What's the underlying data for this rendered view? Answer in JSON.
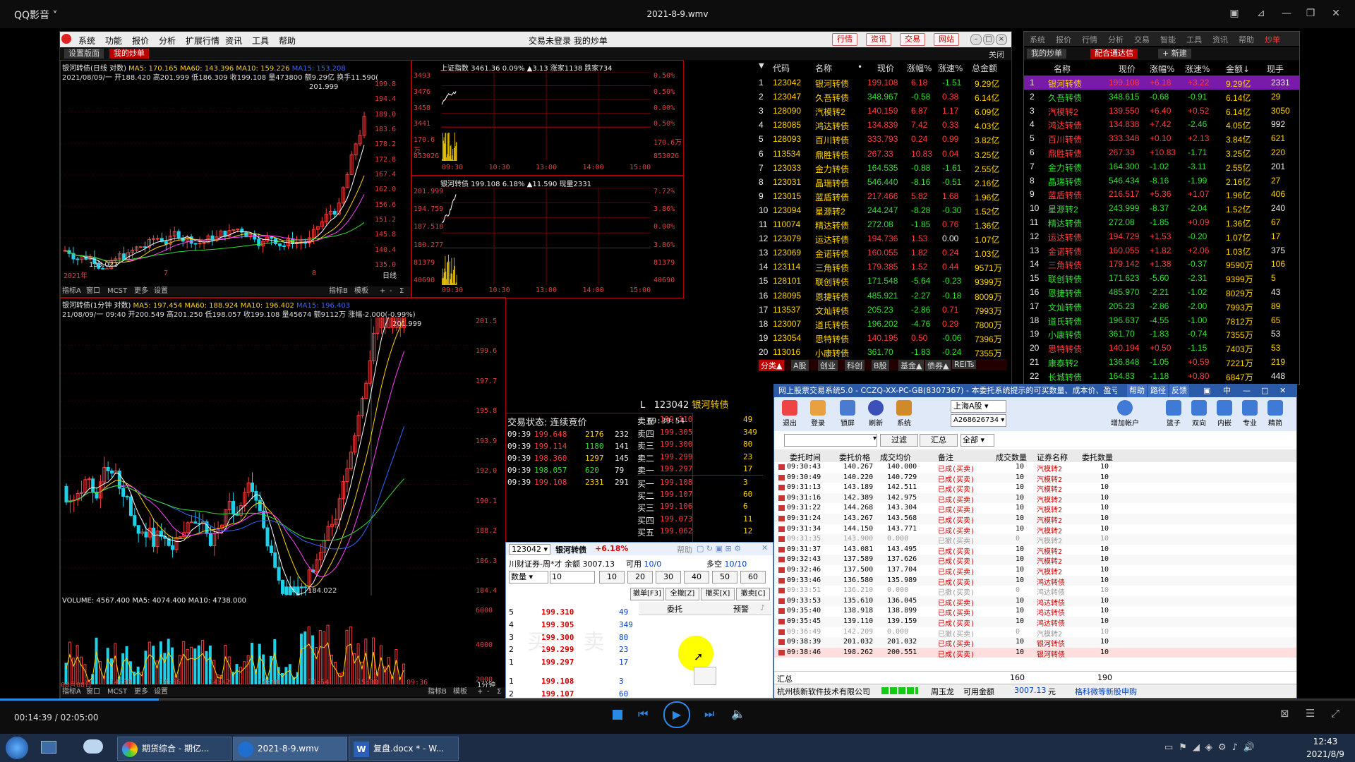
{
  "player": {
    "brand": "QQ影音 ˅",
    "file_title": "2021-8-9.wmv",
    "time": "00:14:39 / 02:05:00",
    "progress": 0.117
  },
  "app": {
    "menu": [
      "系统",
      "功能",
      "报价",
      "分析",
      "扩展行情",
      "资讯",
      "工具",
      "帮助"
    ],
    "center_title": "交易未登录 我的炒单",
    "tool_buttons": [
      "行情",
      "资讯",
      "交易",
      "网站"
    ],
    "close_label": "关闭",
    "tabs": [
      "设置版面",
      "我的炒单"
    ]
  },
  "daily_chart": {
    "header1_name": "银河转债(日线 对数)",
    "header1_ma": "MA5: 170.165  MA60: 143.396  MA10: 159.226",
    "header1_extra": "MA15: 153.208",
    "header2": "2021/08/09/一 开188.420 高201.999 低186.309 收199.108 量473800 额9.29亿 换手11.590(",
    "max_label": "201.999",
    "min_label": "133.023",
    "yaxis": [
      "199.8",
      "194.4",
      "189.0",
      "183.6",
      "178.2",
      "172.8",
      "167.4",
      "162.0",
      "156.6",
      "151.2",
      "145.8",
      "140.4",
      "135.0"
    ],
    "xlabels": [
      "2021年",
      "7",
      "8"
    ],
    "period": "日线",
    "bottom": [
      "指标A",
      "窗口",
      "MCST",
      "更多",
      "设置"
    ],
    "bottom_right": [
      "指标B",
      "模板",
      "+",
      "-",
      "Σ"
    ]
  },
  "index_chart": {
    "header": "上证指数  3461.36  0.09%  ▲3.13  涨家1138  跌家734",
    "yleft": [
      "3493",
      "3476",
      "3458",
      "3441",
      "170.6万",
      "853026"
    ],
    "yright": [
      "0.50%",
      "0.50%",
      "0.00%",
      "0.50%",
      "170.6万",
      "853026"
    ],
    "xlabels": [
      "09:30",
      "10:30",
      "13:00",
      "14:00",
      "15:00"
    ]
  },
  "bond_intraday": {
    "header": "银河转债  199.108  6.18%  ▲11.590  现量2331",
    "yleft": [
      "201.999",
      "194.759",
      "187.518",
      "180.277",
      "81379",
      "40690"
    ],
    "yright": [
      "7.72%",
      "3.86%",
      "0.00%",
      "3.86%",
      "81379",
      "40690"
    ],
    "xlabels": [
      "09:30",
      "10:30",
      "13:00",
      "14:00",
      "15:00"
    ]
  },
  "min_chart": {
    "header1_name": "银河转债(1分钟 对数)",
    "header1_ma": "MA5: 197.454  MA60: 188.924  MA10: 196.402",
    "header1_extra": "MA15: 196.403",
    "header2": "21/08/09/一 09:40 开200.549 高201.250 低198.057 收199.108 量45674 额9112万 涨幅-2.000(-0.99%)",
    "max_label": "201.999",
    "min_label": "184.022",
    "yaxis": [
      "201.5",
      "199.6",
      "197.7",
      "195.8",
      "193.9",
      "192.0",
      "190.1",
      "188.2",
      "186.3",
      "184.4"
    ],
    "volume_header": "VOLUME: 4567.400  MA5: 4074.400  MA10: 4738.000",
    "vol_axis": [
      "6000",
      "4000",
      "2000"
    ],
    "xlabels": [
      "08月08日",
      "14:30",
      "14:36",
      "14:42",
      "14:48",
      "14:54",
      "15:00",
      "09:36"
    ],
    "period": "1分钟",
    "bottom": [
      "指标A",
      "窗口",
      "MCST",
      "更多",
      "设置"
    ],
    "bottom_right": [
      "指标B",
      "模板",
      "+",
      "-",
      "Σ"
    ]
  },
  "quote_table": {
    "headers": [
      "代码",
      "名称",
      "•",
      "现价",
      "涨幅%",
      "涨速%",
      "总金额"
    ],
    "rows": [
      [
        "1",
        "123042",
        "银河转债",
        "199.108",
        "6.18",
        "-1.51",
        "9.29亿"
      ],
      [
        "2",
        "123047",
        "久吾转债",
        "348.967",
        "-0.58",
        "0.38",
        "6.14亿"
      ],
      [
        "3",
        "128090",
        "汽模转2",
        "140.159",
        "6.87",
        "1.17",
        "6.09亿"
      ],
      [
        "4",
        "128085",
        "鸿达转债",
        "134.839",
        "7.42",
        "0.33",
        "4.03亿"
      ],
      [
        "5",
        "128093",
        "百川转债",
        "333.793",
        "0.24",
        "0.99",
        "3.82亿"
      ],
      [
        "6",
        "113534",
        "鼎胜转债",
        "267.33",
        "10.83",
        "0.04",
        "3.25亿"
      ],
      [
        "7",
        "123033",
        "金力转债",
        "164.535",
        "-0.88",
        "-1.61",
        "2.55亿"
      ],
      [
        "8",
        "123031",
        "晶瑞转债",
        "546.440",
        "-8.16",
        "-0.51",
        "2.16亿"
      ],
      [
        "9",
        "123015",
        "蓝盾转债",
        "217.466",
        "5.82",
        "1.68",
        "1.96亿"
      ],
      [
        "10",
        "123094",
        "星源转2",
        "244.247",
        "-8.28",
        "-0.30",
        "1.52亿"
      ],
      [
        "11",
        "110074",
        "精达转债",
        "272.08",
        "-1.85",
        "0.76",
        "1.36亿"
      ],
      [
        "12",
        "123079",
        "运达转债",
        "194.736",
        "1.53",
        "0.00",
        "1.07亿"
      ],
      [
        "13",
        "123069",
        "金诺转债",
        "160.055",
        "1.82",
        "0.24",
        "1.03亿"
      ],
      [
        "14",
        "123114",
        "三角转债",
        "179.385",
        "1.52",
        "0.44",
        "9571万"
      ],
      [
        "15",
        "128101",
        "联创转债",
        "171.548",
        "-5.64",
        "-0.23",
        "9399万"
      ],
      [
        "16",
        "128095",
        "恩捷转债",
        "485.921",
        "-2.27",
        "-0.18",
        "8009万"
      ],
      [
        "17",
        "113537",
        "文灿转债",
        "205.23",
        "-2.86",
        "0.71",
        "7993万"
      ],
      [
        "18",
        "123007",
        "道氏转债",
        "196.202",
        "-4.76",
        "0.29",
        "7800万"
      ],
      [
        "19",
        "123054",
        "思特转债",
        "140.195",
        "0.50",
        "-0.06",
        "7396万"
      ],
      [
        "20",
        "113016",
        "小康转债",
        "361.70",
        "-1.83",
        "-0.24",
        "7355万"
      ]
    ],
    "bottom_tabs": [
      "分类▲",
      "A股",
      "创业",
      "科创",
      "B股",
      "基金▲",
      "债券▲",
      "REITs"
    ]
  },
  "right_panel": {
    "menu": [
      "系统",
      "报价",
      "行情",
      "分析",
      "交易",
      "智能",
      "工具",
      "资讯",
      "帮助",
      "炒单"
    ],
    "tabs": [
      "我的炒单",
      "配合通达信",
      "+ 新建"
    ],
    "headers": [
      "名称",
      "现价",
      "涨幅%",
      "涨速%",
      "金额↓",
      "现手"
    ],
    "rows": [
      [
        "1",
        "银河转债",
        "199.108",
        "+6.18",
        "+3.22",
        "9.29亿",
        "2331"
      ],
      [
        "2",
        "久吾转债",
        "348.615",
        "-0.68",
        "-0.91",
        "6.14亿",
        "29"
      ],
      [
        "3",
        "汽模转2",
        "139.550",
        "+6.40",
        "+0.52",
        "6.14亿",
        "3050"
      ],
      [
        "4",
        "鸿达转债",
        "134.838",
        "+7.42",
        "-2.46",
        "4.05亿",
        "992"
      ],
      [
        "5",
        "百川转债",
        "333.348",
        "+0.10",
        "+2.13",
        "3.84亿",
        "621"
      ],
      [
        "6",
        "鼎胜转债",
        "267.33",
        "+10.83",
        "-1.71",
        "3.25亿",
        "220"
      ],
      [
        "7",
        "金力转债",
        "164.300",
        "-1.02",
        "-3.11",
        "2.55亿",
        "201"
      ],
      [
        "8",
        "晶瑞转债",
        "546.434",
        "-8.16",
        "-1.99",
        "2.16亿",
        "27"
      ],
      [
        "9",
        "蓝盾转债",
        "216.517",
        "+5.36",
        "+1.07",
        "1.96亿",
        "406"
      ],
      [
        "10",
        "星源转2",
        "243.999",
        "-8.37",
        "-2.04",
        "1.52亿",
        "240"
      ],
      [
        "11",
        "精达转债",
        "272.08",
        "-1.85",
        "+0.09",
        "1.36亿",
        "67"
      ],
      [
        "12",
        "运达转债",
        "194.729",
        "+1.53",
        "-0.20",
        "1.07亿",
        "17"
      ],
      [
        "13",
        "金诺转债",
        "160.055",
        "+1.82",
        "+2.06",
        "1.03亿",
        "375"
      ],
      [
        "14",
        "三角转债",
        "179.142",
        "+1.38",
        "-0.37",
        "9590万",
        "106"
      ],
      [
        "15",
        "联创转债",
        "171.623",
        "-5.60",
        "-2.31",
        "9399万",
        "5"
      ],
      [
        "16",
        "恩捷转债",
        "485.970",
        "-2.21",
        "-1.02",
        "8029万",
        "43"
      ],
      [
        "17",
        "文灿转债",
        "205.23",
        "-2.86",
        "-2.00",
        "7993万",
        "89"
      ],
      [
        "18",
        "道氏转债",
        "196.637",
        "-4.55",
        "-1.00",
        "7812万",
        "65"
      ],
      [
        "19",
        "小康转债",
        "361.70",
        "-1.83",
        "-0.74",
        "7355万",
        "53"
      ],
      [
        "20",
        "思特转债",
        "140.194",
        "+0.50",
        "-1.15",
        "7403万",
        "53"
      ],
      [
        "21",
        "康泰转2",
        "136.848",
        "-1.05",
        "+0.59",
        "7221万",
        "219"
      ],
      [
        "22",
        "长城转债",
        "164.83",
        "-1.18",
        "+0.80",
        "6847万",
        "448"
      ]
    ]
  },
  "tick": {
    "status": "交易状态: 连续竞价",
    "status_time": "09:39:54",
    "rows": [
      [
        "09:39",
        "199.648",
        "2176",
        "232"
      ],
      [
        "09:39",
        "199.114",
        "1180",
        "141"
      ],
      [
        "09:39",
        "198.360",
        "1297",
        "145"
      ],
      [
        "09:39",
        "198.057",
        "620",
        "79"
      ],
      [
        "09:39",
        "199.108",
        "2331",
        "291"
      ]
    ],
    "code_label": "L",
    "code": "123042",
    "name": "银河转债",
    "book": [
      [
        "卖五",
        "199.310",
        "49"
      ],
      [
        "卖四",
        "199.305",
        "349"
      ],
      [
        "卖三",
        "199.300",
        "80"
      ],
      [
        "卖二",
        "199.299",
        "23"
      ],
      [
        "卖一",
        "199.297",
        "17"
      ],
      [
        "买一",
        "199.108",
        "3"
      ],
      [
        "买二",
        "199.107",
        "60"
      ],
      [
        "买三",
        "199.106",
        "6"
      ],
      [
        "买四",
        "199.073",
        "11"
      ],
      [
        "买五",
        "199.062",
        "12"
      ]
    ]
  },
  "order_panel": {
    "code": "123042 ▾",
    "name": "银河转债",
    "change": "+6.18%",
    "top_right": "帮助",
    "account": "川财证券-周*才 余额 3007.13",
    "avail_label": "可用",
    "avail": "10/0",
    "short_label": "多空",
    "short": "10/10",
    "qty_label": "数量",
    "qty": "10",
    "qty_buttons": [
      "10",
      "20",
      "30",
      "40",
      "50",
      "60"
    ],
    "action_buttons": [
      "撤单[F3]",
      "全撤[Z]",
      "撤买[X]",
      "撤卖[C]"
    ],
    "book": [
      [
        "5",
        "199.310",
        "49"
      ],
      [
        "4",
        "199.305",
        "349"
      ],
      [
        "3",
        "199.300",
        "80"
      ],
      [
        "2",
        "199.299",
        "23"
      ],
      [
        "1",
        "199.297",
        "17"
      ],
      [
        "1",
        "199.108",
        "3"
      ],
      [
        "2",
        "199.107",
        "60"
      ]
    ],
    "watermark": "买 卖",
    "tabs": [
      "委托",
      "预警"
    ]
  },
  "trade_window": {
    "title": "网上股票交易系统5.0 - CCZQ-XX-PC-GB(8307367) - 本委托系统提示的可买数量、成本价、盈亏等",
    "title_buttons": [
      "帮助",
      "路径",
      "反馈"
    ],
    "toolbar": [
      "退出",
      "登录",
      "锁屏",
      "刷新",
      "系统"
    ],
    "market": "上海A股",
    "account": "A268626734",
    "right_toolbar": [
      "增加帐户",
      "篮子",
      "双向",
      "内嵌",
      "专业",
      "精简"
    ],
    "filter_buttons": [
      "过滤",
      "汇总"
    ],
    "filter_select": "全部",
    "headers": [
      "委托时间",
      "委托价格",
      "成交均价",
      "备注",
      "成交数量",
      "证券名称",
      "委托数量"
    ],
    "rows": [
      [
        "09:30:43",
        "140.267",
        "140.000",
        "已成(买卖)",
        "10",
        "汽模转2",
        "10"
      ],
      [
        "09:30:49",
        "140.220",
        "140.729",
        "已成(买卖)",
        "10",
        "汽模转2",
        "10"
      ],
      [
        "09:31:13",
        "143.189",
        "142.511",
        "已成(买卖)",
        "10",
        "汽模转2",
        "10"
      ],
      [
        "09:31:16",
        "142.389",
        "142.975",
        "已成(买卖)",
        "10",
        "汽模转2",
        "10"
      ],
      [
        "09:31:22",
        "144.268",
        "143.304",
        "已成(买卖)",
        "10",
        "汽模转2",
        "10"
      ],
      [
        "09:31:24",
        "143.267",
        "143.568",
        "已成(买卖)",
        "10",
        "汽模转2",
        "10"
      ],
      [
        "09:31:34",
        "144.150",
        "143.771",
        "已成(买卖)",
        "10",
        "汽模转2",
        "10"
      ],
      [
        "09:31:35",
        "143.900",
        "0.000",
        "已撤(买卖)",
        "0",
        "汽模转2",
        "10"
      ],
      [
        "09:31:37",
        "143.081",
        "143.495",
        "已成(买卖)",
        "10",
        "汽模转2",
        "10"
      ],
      [
        "09:32:43",
        "137.589",
        "137.626",
        "已成(买卖)",
        "10",
        "汽模转2",
        "10"
      ],
      [
        "09:32:46",
        "137.500",
        "137.704",
        "已成(买卖)",
        "10",
        "汽模转2",
        "10"
      ],
      [
        "09:33:46",
        "136.580",
        "135.989",
        "已成(买卖)",
        "10",
        "鸿达转债",
        "10"
      ],
      [
        "09:33:51",
        "136.210",
        "0.000",
        "已撤(买卖)",
        "0",
        "鸿达转债",
        "10"
      ],
      [
        "09:33:53",
        "135.610",
        "136.045",
        "已成(买卖)",
        "10",
        "鸿达转债",
        "10"
      ],
      [
        "09:35:40",
        "138.918",
        "138.899",
        "已成(买卖)",
        "10",
        "鸿达转债",
        "10"
      ],
      [
        "09:35:45",
        "139.110",
        "139.159",
        "已成(买卖)",
        "10",
        "鸿达转债",
        "10"
      ],
      [
        "09:36:49",
        "142.209",
        "0.000",
        "已撤(买卖)",
        "0",
        "汽模转2",
        "10"
      ],
      [
        "09:38:39",
        "201.032",
        "201.032",
        "已成(买卖)",
        "10",
        "银河转债",
        "10"
      ],
      [
        "09:38:46",
        "198.262",
        "200.551",
        "已成(买卖)",
        "10",
        "银河转债",
        "10"
      ]
    ],
    "summary_label": "汇总",
    "summary_filled": "160",
    "summary_qty": "190",
    "status_company": "杭州核新软件技术有限公司",
    "status_user": "周玉龙",
    "status_funds_label": "可用金额",
    "status_funds": "3007.13",
    "status_unit": "元",
    "status_link": "格科微等新股申购"
  },
  "taskbar": {
    "items": [
      "期货综合 - 期亿...",
      "2021-8-9.wmv",
      "复盘.docx * - W..."
    ],
    "time": "12:43",
    "date": "2021/8/9"
  },
  "colors": {
    "up": "#ff3c3c",
    "down": "#33dd33",
    "accent": "#b00000",
    "name": "#ffd400"
  }
}
